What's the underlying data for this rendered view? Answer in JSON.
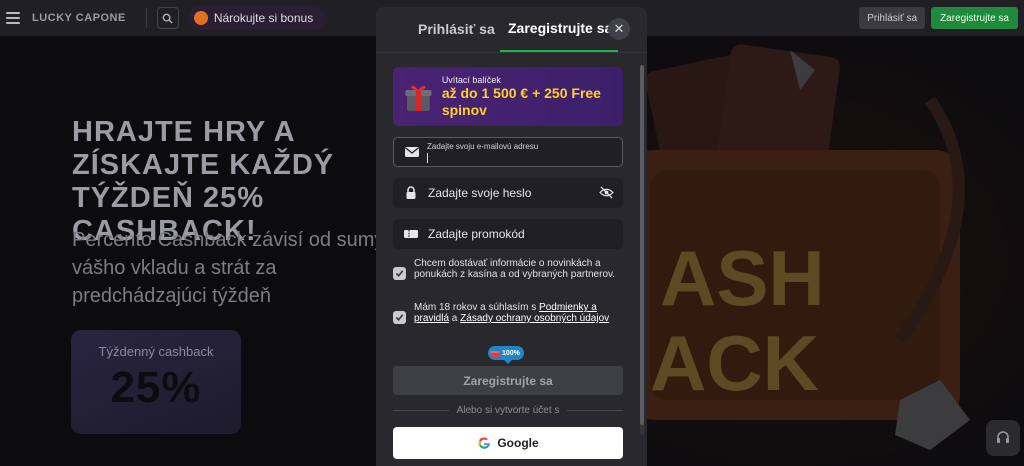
{
  "header": {
    "logo_text": "LUCKY CAPONE",
    "bonus_label": "Nárokujte si bonus",
    "login_label": "Prihlásiť sa",
    "register_label": "Zaregistrujte sa"
  },
  "hero": {
    "title": "HRAJTE HRY A ZÍSKAJTE KAŽDÝ TÝŽDEŇ 25% CASHBACK!",
    "subtitle": "Percento Cashback závisí od sumy vášho vkladu a strát za predchádzajúci týždeň",
    "card_label": "Týždenný cashback",
    "card_value": "25%"
  },
  "modal": {
    "tabs": [
      {
        "label": "Prihlásiť sa",
        "active": false
      },
      {
        "label": "Zaregistrujte sa",
        "active": true
      }
    ],
    "promo": {
      "small": "Uvítací balíček",
      "big": "až do 1 500 € + 250 Free spinov"
    },
    "email": {
      "label": "Zadajte svoju e-mailovú adresu",
      "value": ""
    },
    "password": {
      "placeholder": "Zadajte svoje heslo"
    },
    "promocode": {
      "placeholder": "Zadajte promokód"
    },
    "consent_marketing": "Chcem dostávať informácie o novinkách a ponukách z kasína a od vybraných partnerov.",
    "consent_terms": {
      "prefix": "Mám 18 rokov a súhlasím s ",
      "terms_link": "Podmienky a pravidlá",
      "middle": " a ",
      "privacy_link": "Zásady ochrany osobných údajov"
    },
    "progress": "100%",
    "submit_label": "Zaregistrujte sa",
    "divider_text": "Alebo si vytvorte účet s",
    "google_label": "Google"
  },
  "colors": {
    "accent_green": "#1fb34a",
    "promo_yellow": "#ffd02a",
    "promo_purple": "#4a2373"
  }
}
